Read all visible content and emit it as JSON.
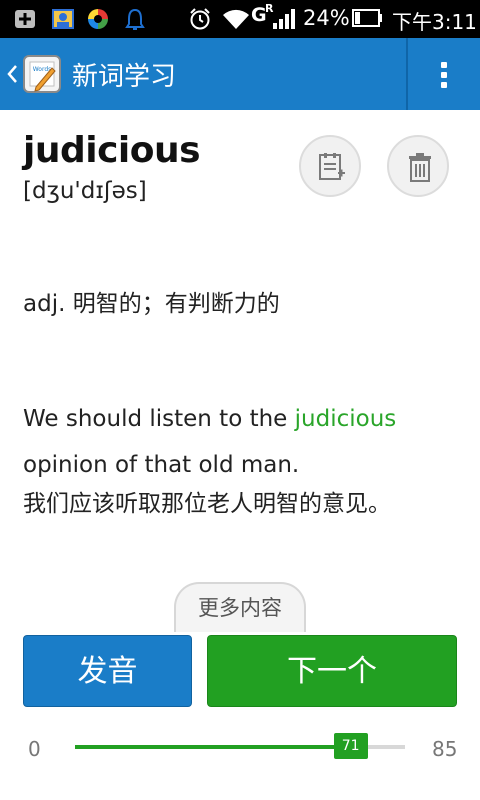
{
  "status_bar": {
    "battery_percent": "24%",
    "time": "下午3:11",
    "network_type": "G",
    "roaming": "R",
    "icons": [
      "add-box-icon",
      "contact-card-icon",
      "app-colorful-icon",
      "alarm-bell-icon",
      "alarm-clock-icon",
      "wifi-icon",
      "signal-icon",
      "battery-icon"
    ]
  },
  "action_bar": {
    "title": "新词学习",
    "app_icon_text": "Words",
    "back_icon": "back-chevron-icon",
    "menu_icon": "overflow-menu-icon"
  },
  "word": {
    "text": "judicious",
    "phonetic": "[dʒu'dɪʃəs]",
    "add_note_icon": "add-to-notebook-icon",
    "delete_icon": "trash-icon"
  },
  "definition": "adj. 明智的；有判断力的",
  "example": {
    "before": "We should listen to the ",
    "highlight": "judicious",
    "after": " opinion of that old man.",
    "translation": "我们应该听取那位老人明智的意见。"
  },
  "more_button": "更多内容",
  "buttons": {
    "pronounce": "发音",
    "next": "下一个"
  },
  "progress": {
    "min": "0",
    "max": "85",
    "current": "71"
  },
  "colors": {
    "primary_blue": "#1a7dc8",
    "accent_green": "#22a022",
    "highlight_green": "#2aa52a"
  }
}
